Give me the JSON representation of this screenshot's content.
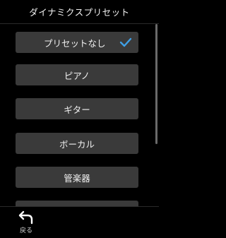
{
  "header": {
    "title": "ダイナミクスプリセット"
  },
  "presets": [
    {
      "label": "プリセットなし",
      "selected": true
    },
    {
      "label": "ピアノ",
      "selected": false
    },
    {
      "label": "ギター",
      "selected": false
    },
    {
      "label": "ボーカル",
      "selected": false
    },
    {
      "label": "管楽器",
      "selected": false
    }
  ],
  "footer": {
    "back_label": "戻る",
    "back_icon": "back-arrow-icon"
  },
  "colors": {
    "accent": "#3fa0e6",
    "item_bg": "#3a3a3a",
    "background": "#000000"
  }
}
